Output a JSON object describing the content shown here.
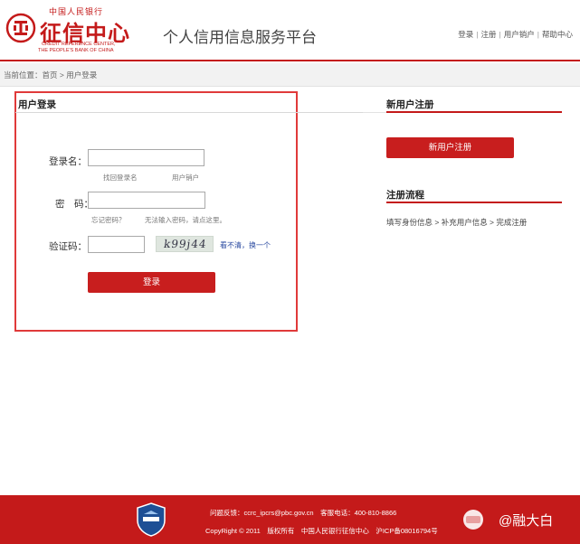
{
  "header": {
    "logo_top": "中国人民银行",
    "logo_main": "征信中心",
    "logo_en1": "CREDIT REFERENCE CENTER,",
    "logo_en2": "THE PEOPLE'S BANK OF CHINA",
    "platform_title": "个人信用信息服务平台",
    "nav": [
      "登录",
      "注册",
      "用户销户",
      "帮助中心"
    ],
    "nav_sep": "|"
  },
  "breadcrumb": "当前位置：首页 > 用户登录",
  "login": {
    "heading": "用户登录",
    "username_label": "登录名：",
    "username_value": "",
    "hint_find_username": "找回登录名",
    "hint_cancel_user": "用户销户",
    "password_label": "密　码：",
    "password_value": "",
    "hint_forgot_password": "忘记密码？",
    "hint_cannot_input": "无法输入密码，请点这里。",
    "captcha_label": "验证码：",
    "captcha_value": "",
    "captcha_image_text": "k99j44",
    "refresh_link": "看不清，换一个",
    "login_button": "登录"
  },
  "sidebar": {
    "new_user_heading": "新用户注册",
    "register_button": "新用户注册",
    "flow_heading": "注册流程",
    "flow_text": "填写身份信息 > 补充用户信息 > 完成注册"
  },
  "footer": {
    "line1": "问题反馈：ccrc_ipcrs@pbc.gov.cn　客服电话：400-810-8866",
    "line2": "CopyRight © 2011　版权所有　中国人民银行征信中心　沪ICP备08016794号",
    "watermark": "@融大白"
  },
  "colors": {
    "brand_red": "#c41a1a",
    "button_red": "#c81e1e",
    "highlight_border": "#e03a3a",
    "link_blue": "#2a4aa0"
  }
}
